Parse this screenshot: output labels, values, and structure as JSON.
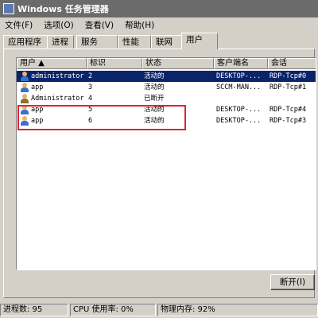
{
  "window": {
    "title": "Windows 任务管理器"
  },
  "menu": [
    "文件(F)",
    "选项(O)",
    "查看(V)",
    "帮助(H)"
  ],
  "tabs": [
    "应用程序",
    "进程",
    "服务",
    "性能",
    "联网",
    "用户"
  ],
  "active_tab": "用户",
  "columns": [
    "用户 ▲",
    "标识",
    "状态",
    "客户端名",
    "会话"
  ],
  "rows": [
    {
      "user": "administrator",
      "id": "2",
      "status": "活动的",
      "client": "DESKTOP-...",
      "session": "RDP-Tcp#0",
      "selected": true
    },
    {
      "user": "app",
      "id": "3",
      "status": "活动的",
      "client": "SCCM-MAN...",
      "session": "RDP-Tcp#1"
    },
    {
      "user": "Administrator",
      "id": "4",
      "status": "已断开",
      "client": "",
      "session": ""
    },
    {
      "user": "app",
      "id": "5",
      "status": "活动的",
      "client": "DESKTOP-...",
      "session": "RDP-Tcp#4"
    },
    {
      "user": "app",
      "id": "6",
      "status": "活动的",
      "client": "DESKTOP-...",
      "session": "RDP-Tcp#3"
    }
  ],
  "buttons": {
    "disconnect": "断开(I)"
  },
  "status": {
    "processes": "进程数: 95",
    "cpu": "CPU 使用率: 0%",
    "memory": "物理内存: 92%"
  },
  "colors": {
    "selection": "#0a246a",
    "highlight_box": "#e0242c"
  }
}
